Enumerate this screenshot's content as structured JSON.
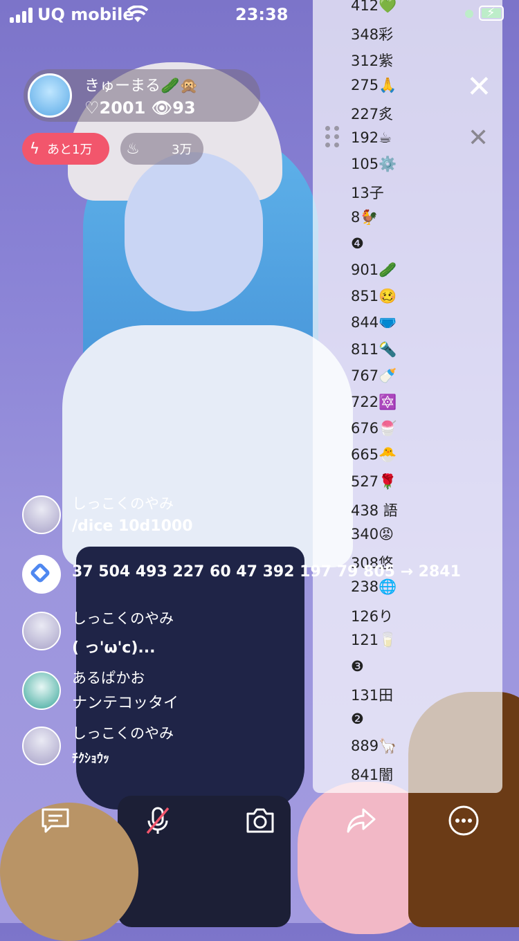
{
  "status_bar": {
    "carrier": "UQ mobile",
    "time": "23:38"
  },
  "host": {
    "name": "きゅーまる🥒🙊",
    "likes": "♡2001",
    "views": "👁93"
  },
  "badges": {
    "remaining": "あと1万",
    "fire": "3万"
  },
  "ranking": [
    "412💚",
    "348彩",
    "312紫",
    "275🙏",
    "227炙",
    "192☕",
    "105⚙️",
    "13子",
    "8🐓",
    "❹",
    "901🥒",
    "851🥴",
    "844🩲",
    "811🔦",
    "767🍼",
    "722🔯",
    "676🍧",
    "665🐣",
    "527🌹",
    "438 語",
    "340😡",
    "308悠",
    "238🌐",
    "126り",
    "121🥛",
    "❸",
    "131田",
    "❷",
    "889🦙",
    "841闇"
  ],
  "comments": [
    {
      "name": "しっこくのやみ",
      "text": "/dice 10d1000"
    },
    {
      "name": "",
      "text": "37 504 493 227 60 47 392 197 79 805 → 2841"
    },
    {
      "name": "しっこくのやみ",
      "text": "( っ'ω'c)..."
    },
    {
      "name": "あるぱかお",
      "text": "ナンテコッタイ"
    },
    {
      "name": "しっこくのやみ",
      "text": "ﾁｸｼｮｳｯ"
    }
  ],
  "toolbar": [
    "comment-icon",
    "mic-off-icon",
    "camera-icon",
    "share-icon",
    "more-icon"
  ],
  "colors": {
    "accent_red": "#f2566c",
    "battery_green": "#34c759"
  }
}
